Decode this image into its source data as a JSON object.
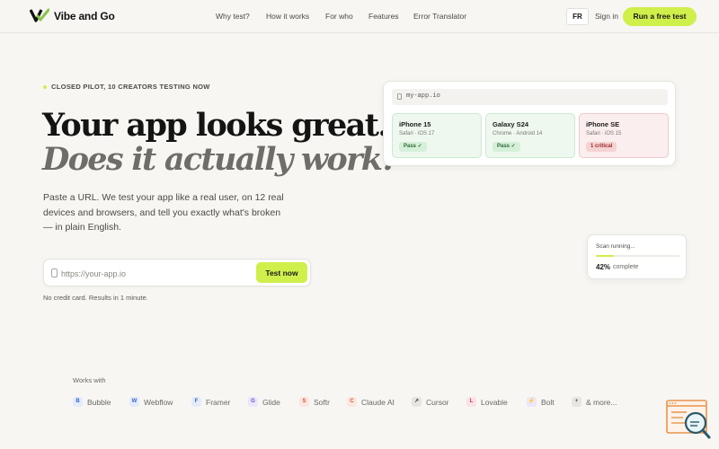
{
  "nav": {
    "brand": "Vibe and Go",
    "links": [
      {
        "label": "Why test?"
      },
      {
        "label": "How it works"
      },
      {
        "label": "For who"
      },
      {
        "label": "Features"
      },
      {
        "label": "Error Translator"
      }
    ],
    "lang": "FR",
    "signin": "Sign in",
    "cta": "Run a free test"
  },
  "hero": {
    "eyebrow": "CLOSED PILOT, 10 CREATORS TESTING NOW",
    "headline": "Your app looks great.",
    "headline_italic": "Does it actually work?",
    "lede": "Paste a URL. We test your app like a real user, on 12 real devices and browsers, and tell you exactly what's broken — in plain English.",
    "url_placeholder": "https://your-app.io",
    "test_button": "Test now",
    "note": "No credit card. Results in 1 minute."
  },
  "preview": {
    "address": "my-app.io",
    "devices": [
      {
        "name": "iPhone 15",
        "browser": "Safari · iOS 17",
        "status": "Pass ✓",
        "state": "pass"
      },
      {
        "name": "Galaxy S24",
        "browser": "Chrome · Android 14",
        "status": "Pass ✓",
        "state": "pass"
      },
      {
        "name": "iPhone SE",
        "browser": "Safari · iOS 15",
        "status": "1 critical",
        "state": "critical"
      }
    ]
  },
  "scan": {
    "label": "Scan running...",
    "percent_text": "42%",
    "progress": 0.42,
    "word": "complete"
  },
  "works_with": {
    "label": "Works with",
    "platforms": [
      {
        "initial": "B",
        "name": "Bubble",
        "bg": "#e4ecfb",
        "fg": "#3a63c8"
      },
      {
        "initial": "W",
        "name": "Webflow",
        "bg": "#e4ecfb",
        "fg": "#3a63c8"
      },
      {
        "initial": "F",
        "name": "Framer",
        "bg": "#e4ecfb",
        "fg": "#3a63c8"
      },
      {
        "initial": "G",
        "name": "Glide",
        "bg": "#ece6fb",
        "fg": "#6b4cc8"
      },
      {
        "initial": "S",
        "name": "Softr",
        "bg": "#fbe6e0",
        "fg": "#c8573a"
      },
      {
        "initial": "C",
        "name": "Claude AI",
        "bg": "#fbe6e0",
        "fg": "#c8573a"
      },
      {
        "initial": "↗",
        "name": "Cursor",
        "bg": "#e6e5e1",
        "fg": "#333333"
      },
      {
        "initial": "L",
        "name": "Lovable",
        "bg": "#fbe2e6",
        "fg": "#c83a55"
      },
      {
        "initial": "⚡",
        "name": "Bolt",
        "bg": "#ece6fb",
        "fg": "#6b4cc8"
      },
      {
        "initial": "+",
        "name": "& more...",
        "bg": "#e6e5e1",
        "fg": "#555555"
      }
    ]
  },
  "colors": {
    "accent": "#cfef4a",
    "background": "#f7f6f3"
  }
}
